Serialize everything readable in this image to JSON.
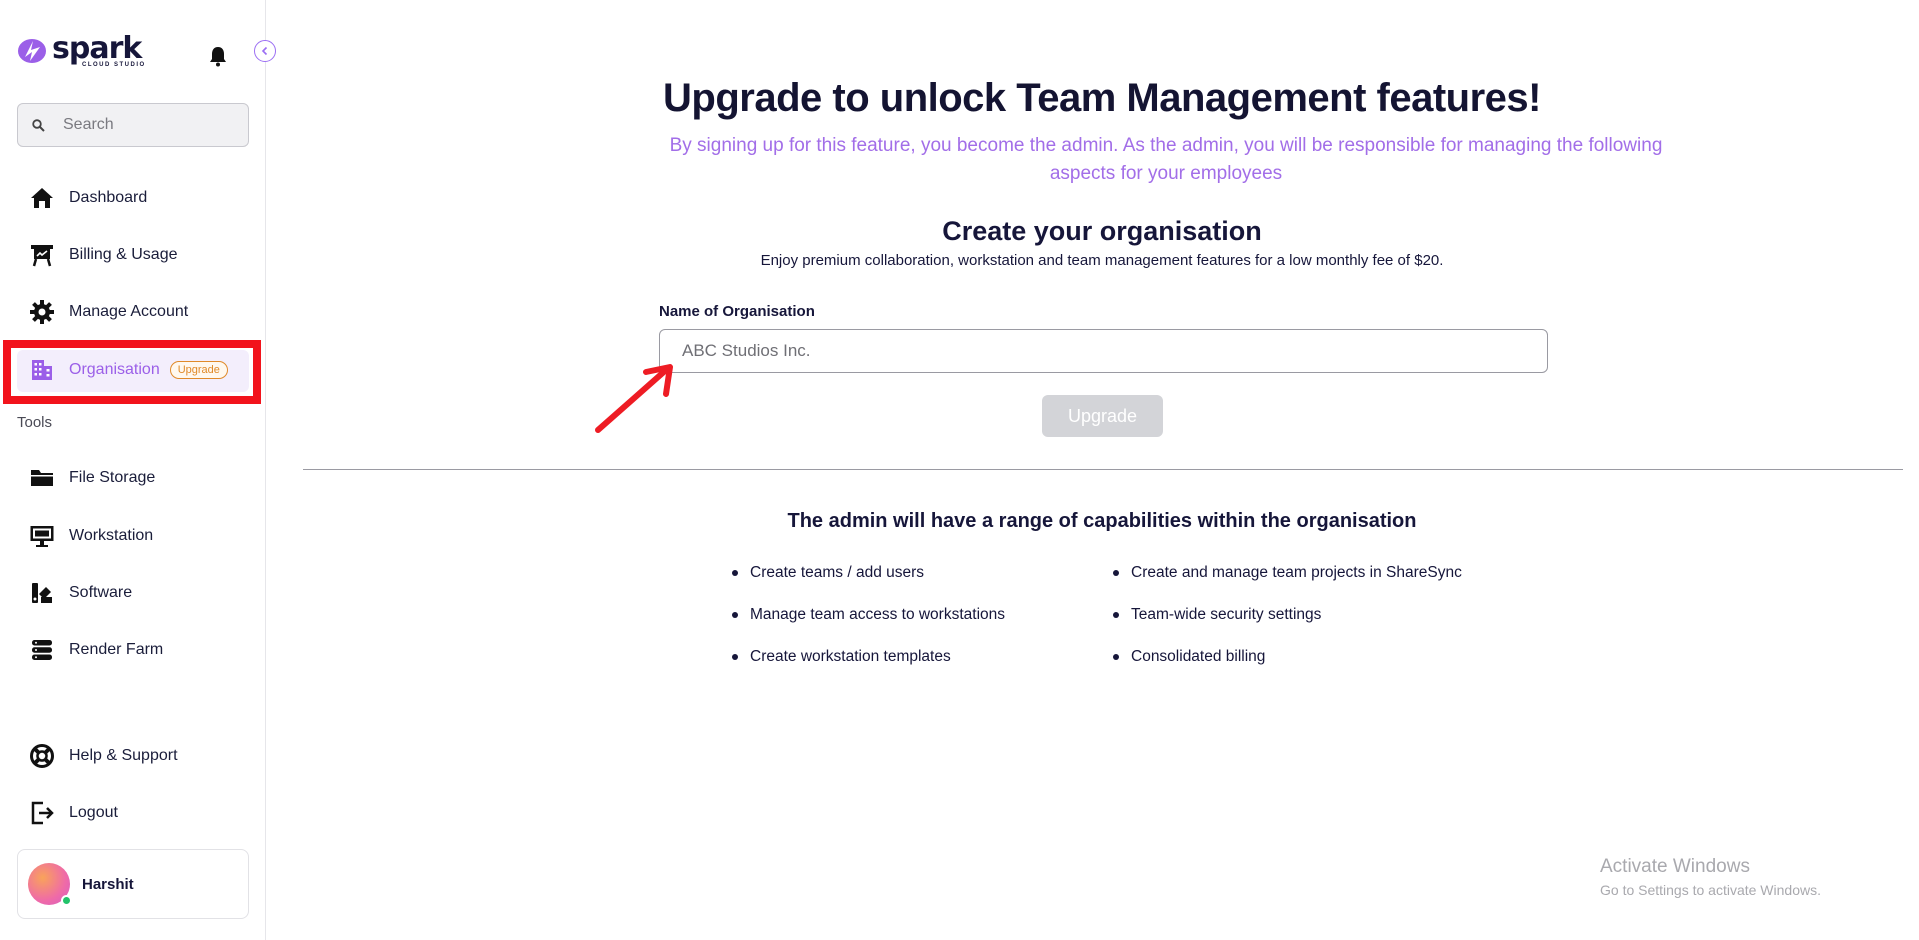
{
  "brand": {
    "name": "spark",
    "tagline": "CLOUD STUDIO",
    "accent": "#9b5fe8"
  },
  "sidebar": {
    "search_placeholder": "Search",
    "items": [
      {
        "label": "Dashboard",
        "icon": "home-icon"
      },
      {
        "label": "Billing & Usage",
        "icon": "billing-icon"
      },
      {
        "label": "Manage Account",
        "icon": "gear-icon"
      },
      {
        "label": "Organisation",
        "icon": "building-icon",
        "badge": "Upgrade",
        "active": true
      }
    ],
    "tools_label": "Tools",
    "tools": [
      {
        "label": "File Storage",
        "icon": "folder-icon"
      },
      {
        "label": "Workstation",
        "icon": "monitor-icon"
      },
      {
        "label": "Software",
        "icon": "software-icon"
      },
      {
        "label": "Render Farm",
        "icon": "server-icon"
      }
    ],
    "bottom": [
      {
        "label": "Help & Support",
        "icon": "lifebuoy-icon"
      },
      {
        "label": "Logout",
        "icon": "logout-icon"
      }
    ],
    "user": {
      "name": "Harshit",
      "status": "online"
    }
  },
  "main": {
    "headline": "Upgrade to unlock Team Management features!",
    "subhead": "By signing up for this feature, you become the admin. As the admin, you will be responsible for managing the following aspects for your employees",
    "section_title": "Create your organisation",
    "section_desc": "Enjoy premium collaboration, workstation and team management features for a low monthly fee of $20.",
    "field_label": "Name of Organisation",
    "field_placeholder": "ABC Studios Inc.",
    "field_value": "",
    "upgrade_button": "Upgrade",
    "capabilities_title": "The admin will have a range of capabilities within the organisation",
    "capabilities_left": [
      "Create teams / add users",
      "Manage team access to workstations",
      "Create workstation templates"
    ],
    "capabilities_right": [
      "Create and manage team projects in ShareSync",
      "Team-wide security settings",
      "Consolidated billing"
    ]
  },
  "watermark": {
    "title": "Activate Windows",
    "subtitle": "Go to Settings to activate Windows."
  }
}
